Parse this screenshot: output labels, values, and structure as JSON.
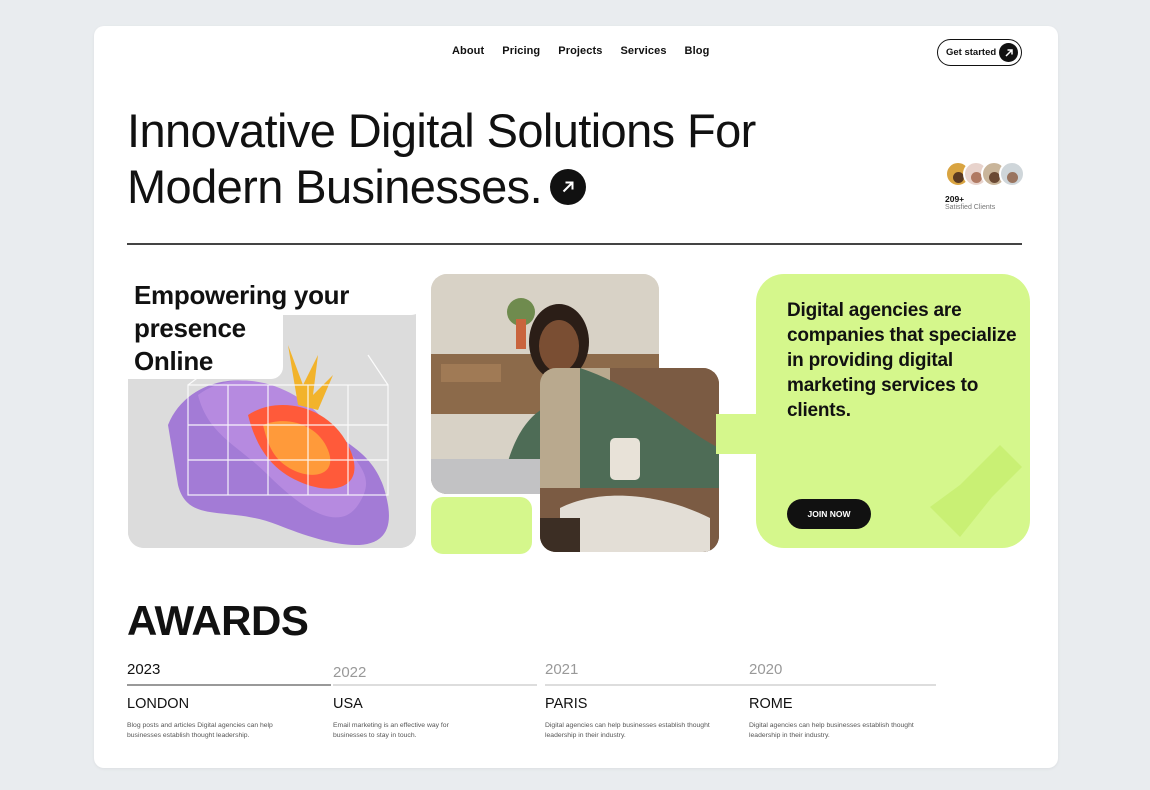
{
  "nav": {
    "items": [
      "About",
      "Pricing",
      "Projects",
      "Services",
      "Blog"
    ],
    "cta_label": "Get started"
  },
  "hero": {
    "title_line1": "Innovative Digital Solutions For",
    "title_line2": "Modern Businesses.",
    "clients_count": "209+",
    "clients_label": "Satisfied Clients"
  },
  "tiles": {
    "empower_line1": "Empowering your",
    "empower_line2": "presence",
    "empower_line3": "Online",
    "agency_text": "Digital agencies are companies that specialize in providing digital marketing services to clients.",
    "join_label": "JOIN NOW"
  },
  "awards": {
    "title": "AWARDS",
    "items": [
      {
        "year": "2023",
        "city": "LONDON",
        "desc": "Blog posts and articles Digital agencies can help businesses establish thought leadership."
      },
      {
        "year": "2022",
        "city": "USA",
        "desc": "Email marketing is an effective way for businesses to stay in touch."
      },
      {
        "year": "2021",
        "city": "PARIS",
        "desc": "Digital agencies can help businesses establish thought leadership in their industry."
      },
      {
        "year": "2020",
        "city": "ROME",
        "desc": "Digital agencies can help businesses establish thought leadership in their industry."
      }
    ]
  },
  "colors": {
    "accent": "#d5f78c",
    "dark": "#111111",
    "background": "#e9ecef"
  }
}
